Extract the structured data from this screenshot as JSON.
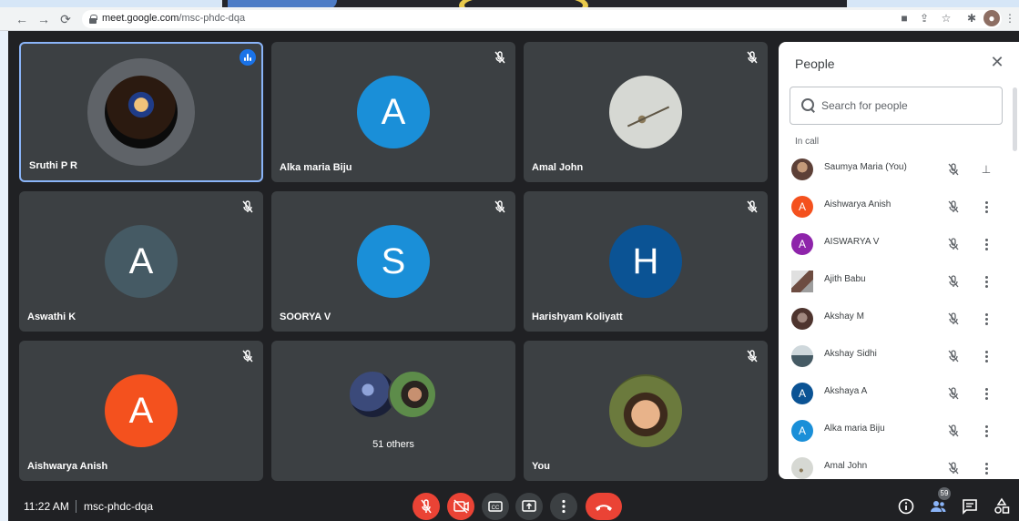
{
  "browser": {
    "url_host": "meet.google.com",
    "url_path": "/msc-phdc-dqa"
  },
  "tiles": [
    {
      "name": "Sruthi P R"
    },
    {
      "name": "Alka maria Biju",
      "initial": "A",
      "color": "#1a8fd8"
    },
    {
      "name": "Amal John"
    },
    {
      "name": "Aswathi K",
      "initial": "A",
      "color": "#455a64"
    },
    {
      "name": "SOORYA V",
      "initial": "S",
      "color": "#1a8fd8"
    },
    {
      "name": "Harishyam Koliyatt",
      "initial": "H",
      "color": "#0b5394"
    },
    {
      "name": "Aishwarya Anish",
      "initial": "A",
      "color": "#f4511e"
    },
    {
      "others": "51 others"
    },
    {
      "name": "You"
    }
  ],
  "people_panel": {
    "title": "People",
    "search_placeholder": "Search for people",
    "section": "In call",
    "participants": [
      {
        "name": "Saumya Maria (You)",
        "avatar": "photo"
      },
      {
        "name": "Aishwarya Anish",
        "initial": "A",
        "color": "#f4511e"
      },
      {
        "name": "AISWARYA V",
        "initial": "A",
        "color": "#8e24aa"
      },
      {
        "name": "Ajith Babu",
        "avatar": "photo"
      },
      {
        "name": "Akshay M",
        "avatar": "photo"
      },
      {
        "name": "Akshay Sidhi",
        "avatar": "photo"
      },
      {
        "name": "Akshaya A",
        "initial": "A",
        "color": "#0b5394"
      },
      {
        "name": "Alka maria Biju",
        "initial": "A",
        "color": "#1a8fd8"
      },
      {
        "name": "Amal John",
        "avatar": "photo"
      }
    ]
  },
  "bottom_bar": {
    "time": "11:22 AM",
    "meeting_code": "msc-phdc-dqa",
    "people_count": "59"
  },
  "colors": {
    "background": "#202124",
    "tile": "#3c4043",
    "accent": "#8ab4f8",
    "danger": "#ea4335"
  }
}
